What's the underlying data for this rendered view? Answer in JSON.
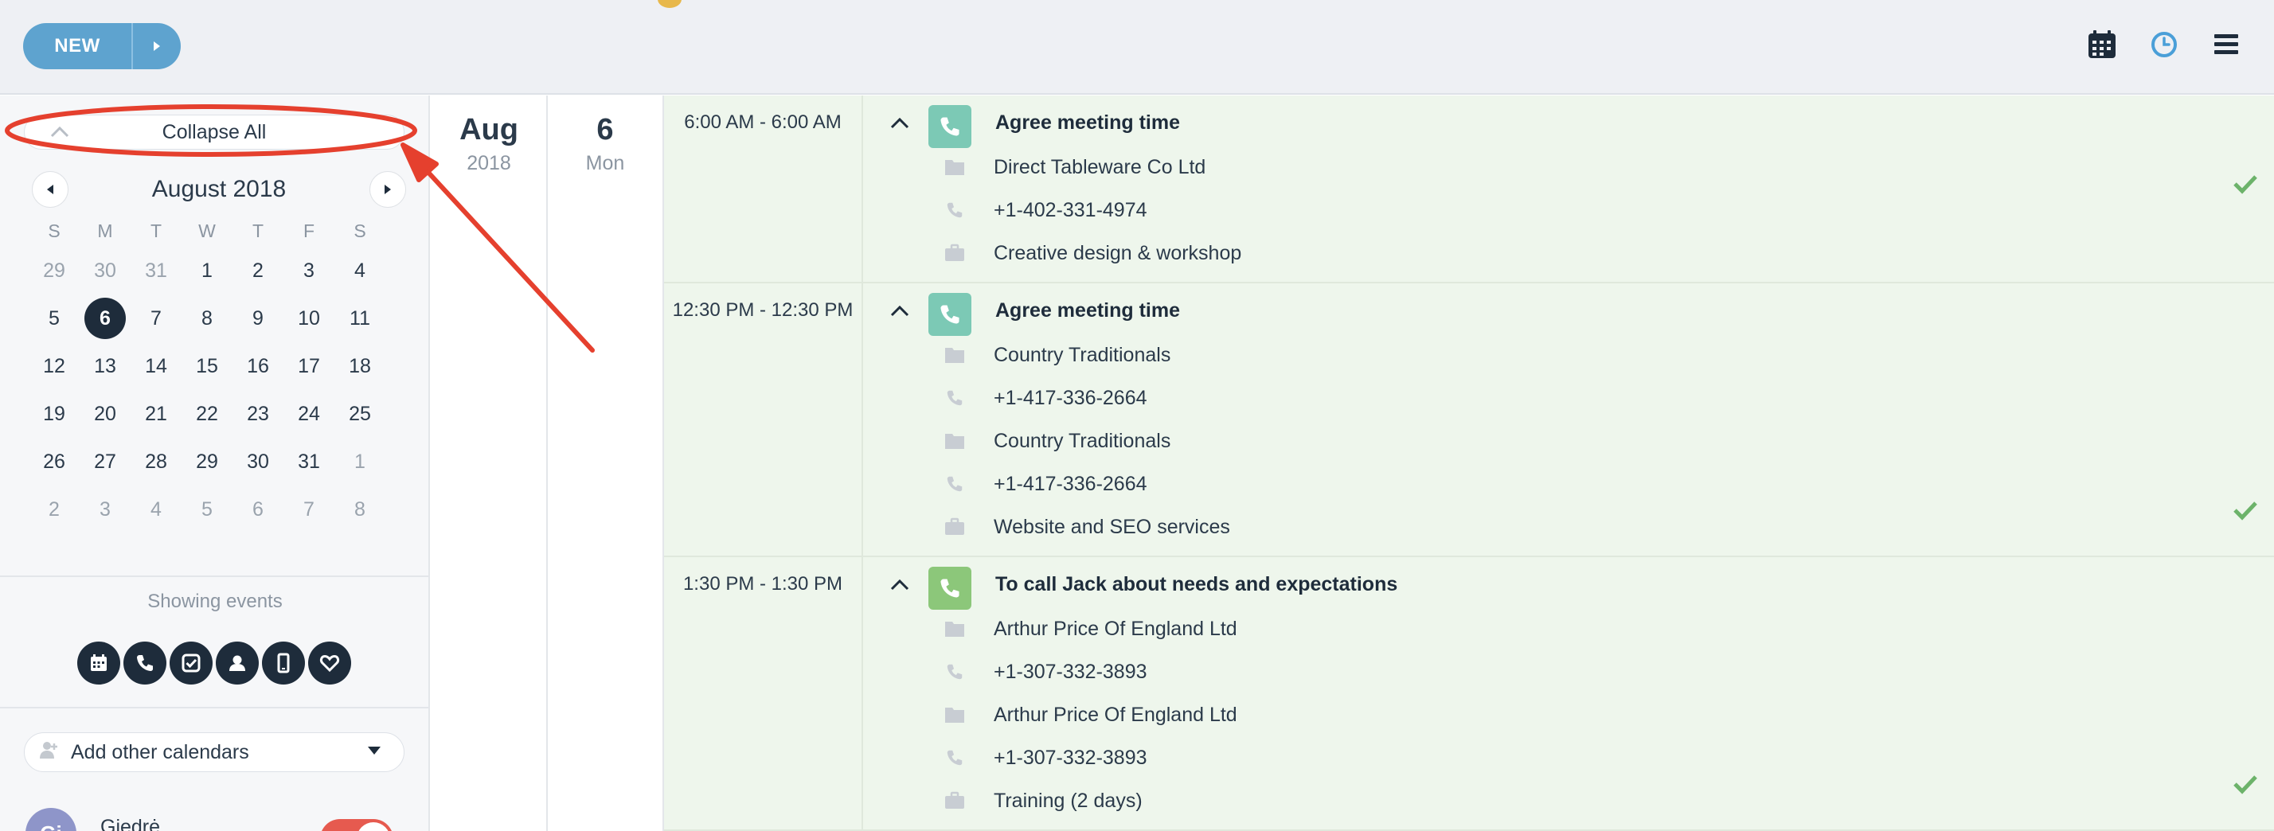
{
  "toolbar": {
    "new_label": "NEW",
    "icons": [
      "calendar-icon",
      "clock-icon",
      "hamburger-menu-icon"
    ],
    "accent_color": "#5ea3cf"
  },
  "sidebar": {
    "collapse_label": "Collapse All",
    "calendar": {
      "title": "August 2018",
      "weekdays": [
        "S",
        "M",
        "T",
        "W",
        "T",
        "F",
        "S"
      ],
      "weeks": [
        [
          "29",
          "30",
          "31",
          "1",
          "2",
          "3",
          "4"
        ],
        [
          "5",
          "6",
          "7",
          "8",
          "9",
          "10",
          "11"
        ],
        [
          "12",
          "13",
          "14",
          "15",
          "16",
          "17",
          "18"
        ],
        [
          "19",
          "20",
          "21",
          "22",
          "23",
          "24",
          "25"
        ],
        [
          "26",
          "27",
          "28",
          "29",
          "30",
          "31",
          "1"
        ],
        [
          "2",
          "3",
          "4",
          "5",
          "6",
          "7",
          "8"
        ]
      ],
      "selected_day": "6"
    },
    "showing_events_label": "Showing events",
    "event_type_filters": [
      "calendar-icon",
      "phone-icon",
      "task-check-icon",
      "contact-person-icon",
      "mobile-icon",
      "heart-icon"
    ],
    "add_calendars_label": "Add other calendars",
    "user": {
      "initials": "Gi",
      "name": "Giedrė",
      "enabled": true
    }
  },
  "date_header": {
    "month": "Aug",
    "year": "2018",
    "day_number": "6",
    "weekday": "Mon"
  },
  "events": [
    {
      "time": "6:00 AM - 6:00 AM",
      "title": "Agree meeting time",
      "type": "phone-call",
      "details": [
        {
          "icon": "folder-icon",
          "text": "Direct Tableware Co Ltd"
        },
        {
          "icon": "phone-icon",
          "text": "+1-402-331-4974"
        },
        {
          "icon": "briefcase-icon",
          "text": "Creative design & workshop"
        }
      ],
      "completed": true
    },
    {
      "time": "12:30 PM - 12:30 PM",
      "title": "Agree meeting time",
      "type": "phone-call",
      "details": [
        {
          "icon": "folder-icon",
          "text": "Country Traditionals"
        },
        {
          "icon": "phone-icon",
          "text": "+1-417-336-2664"
        },
        {
          "icon": "folder-icon",
          "text": "Country Traditionals"
        },
        {
          "icon": "phone-icon",
          "text": "+1-417-336-2664"
        },
        {
          "icon": "briefcase-icon",
          "text": "Website and SEO services"
        }
      ],
      "completed": true
    },
    {
      "time": "1:30 PM - 1:30 PM",
      "title": "To call Jack about needs and expectations",
      "type": "phone-call",
      "details": [
        {
          "icon": "folder-icon",
          "text": "Arthur Price Of England Ltd"
        },
        {
          "icon": "phone-icon",
          "text": "+1-307-332-3893"
        },
        {
          "icon": "folder-icon",
          "text": "Arthur Price Of England Ltd"
        },
        {
          "icon": "phone-icon",
          "text": "+1-307-332-3893"
        },
        {
          "icon": "briefcase-icon",
          "text": "Training (2 days)"
        }
      ],
      "completed": true
    }
  ],
  "colors": {
    "event_bg": "#eef6ec",
    "phone_badge_teal": "#7cc9b5",
    "phone_badge_green": "#8cc77a",
    "check_green": "#6cb36a",
    "annotation_red": "#e5402e"
  }
}
